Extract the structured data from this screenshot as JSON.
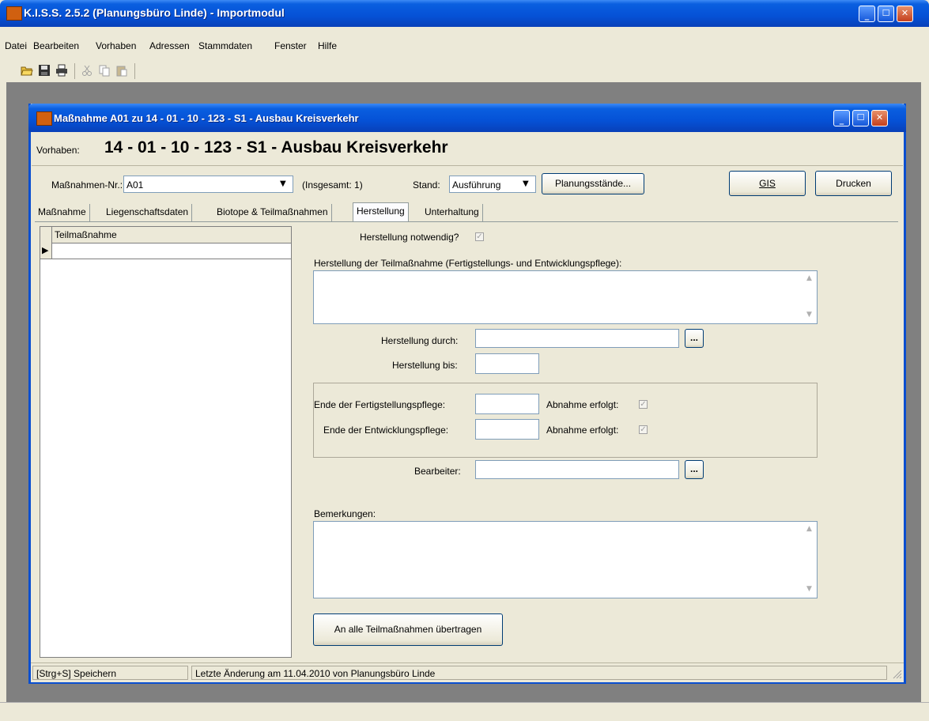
{
  "app": {
    "title": "K.I.S.S. 2.5.2 (Planungsbüro Linde) - Importmodul"
  },
  "menu": [
    "Datei",
    "Bearbeiten",
    "Vorhaben",
    "Adressen",
    "Stammdaten",
    "Fenster",
    "Hilfe"
  ],
  "toolbar": {
    "icons": [
      "open-icon",
      "save-icon",
      "print-icon",
      "cut-icon",
      "copy-icon",
      "paste-icon"
    ]
  },
  "window": {
    "title": "Maßnahme A01 zu 14 - 01 - 10 - 123 - S1 - Ausbau Kreisverkehr",
    "vorhaben_label": "Vorhaben:",
    "vorhaben_value": "14 - 01 - 10 - 123 - S1 - Ausbau Kreisverkehr"
  },
  "header": {
    "massnahmen_label": "Maßnahmen-Nr.:",
    "massnahmen_value": "A01",
    "insgesamt": "(Insgesamt: 1)",
    "stand_label": "Stand:",
    "stand_value": "Ausführung",
    "planungsstaende_button": "Planungsstände...",
    "gis_button": "GIS",
    "drucken_button": "Drucken"
  },
  "tabs": [
    "Maßnahme",
    "Liegenschaftsdaten",
    "Biotope & Teilmaßnahmen",
    "Herstellung",
    "Unterhaltung"
  ],
  "active_tab": "Herstellung",
  "grid": {
    "column_header": "Teilmaßnahme",
    "row_marker": "▶"
  },
  "form": {
    "herstellung_notwendig_label": "Herstellung notwendig?",
    "herstellung_notwendig_checked": true,
    "herstellung_teilmassnahme_label": "Herstellung der Teilmaßnahme  (Fertigstellungs- und Entwicklungspflege):",
    "herstellung_teilmassnahme_value": "",
    "herstellung_durch_label": "Herstellung durch:",
    "herstellung_durch_value": "",
    "herstellung_bis_label": "Herstellung bis:",
    "herstellung_bis_value": "",
    "ende_fertigstellung_label": "Ende der Fertigstellungspflege:",
    "ende_fertigstellung_value": "",
    "ende_entwicklung_label": "Ende der Entwicklungspflege:",
    "ende_entwicklung_value": "",
    "abnahme_label_1": "Abnahme erfolgt:",
    "abnahme_label_2": "Abnahme erfolgt:",
    "bearbeiter_label": "Bearbeiter:",
    "bearbeiter_value": "",
    "bemerkungen_label": "Bemerkungen:",
    "bemerkungen_value": "",
    "ellipsis_button": "...",
    "uebertragen_button": "An alle Teilmaßnahmen übertragen"
  },
  "statusbar": {
    "left": "[Strg+S] Speichern",
    "right": "Letzte Änderung am 11.04.2010 von Planungsbüro Linde"
  }
}
